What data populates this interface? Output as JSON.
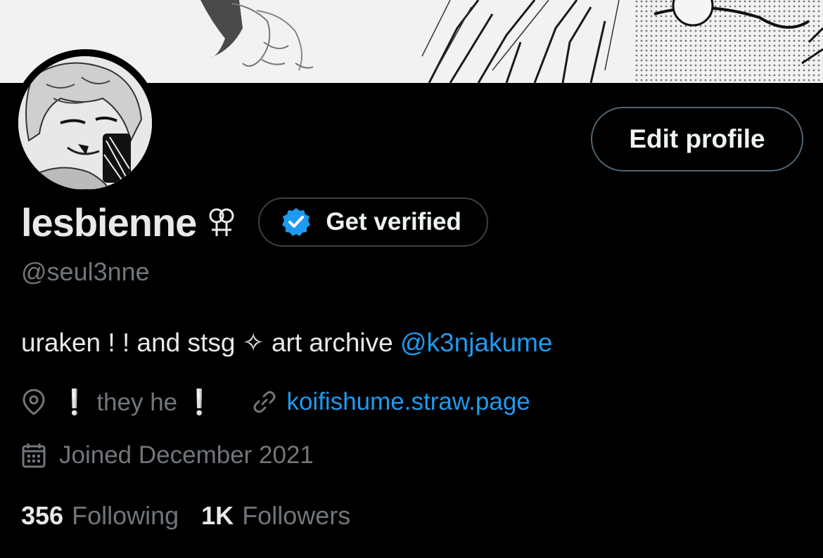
{
  "profile": {
    "display_name": "lesbienne",
    "name_emoji_icon": "lesbian-symbol-icon",
    "verify_label": "Get verified",
    "handle": "@seul3nne",
    "bio": {
      "text": "uraken ! ! and stsg ✧ art archive ",
      "mention": "@k3njakume"
    },
    "location": {
      "icon": "location-pin-icon",
      "excl_start": "❕",
      "text": " they he ",
      "excl_end": "❕"
    },
    "website": {
      "icon": "link-icon",
      "text": "koifishume.straw.page"
    },
    "joined": {
      "icon": "calendar-icon",
      "text": "Joined December 2021"
    },
    "following": {
      "count": "356",
      "label": "Following"
    },
    "followers": {
      "count": "1K",
      "label": "Followers"
    }
  },
  "actions": {
    "edit_profile": "Edit profile"
  },
  "colors": {
    "background": "#000000",
    "text_primary": "#e7e9ea",
    "text_secondary": "#71767b",
    "link": "#1d9bf0",
    "verified_badge": "#1d9bf0"
  }
}
